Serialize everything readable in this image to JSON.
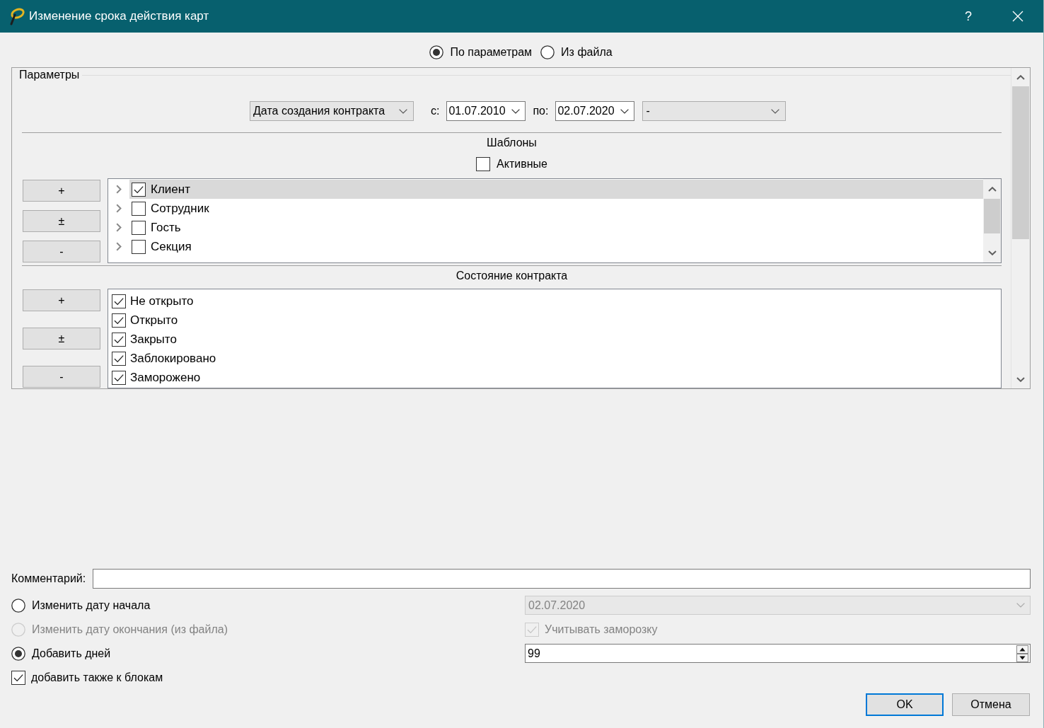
{
  "window": {
    "title": "Изменение срока действия карт",
    "help_button": "?"
  },
  "mode_options": [
    {
      "label": "По параметрам",
      "selected": true
    },
    {
      "label": "Из файла",
      "selected": false
    }
  ],
  "parameters": {
    "title": "Параметры",
    "date_type": "Дата создания контракта",
    "from_label": "с:",
    "from_date": "01.07.2010",
    "to_label": "по:",
    "to_date": "02.07.2020",
    "extra_filter": "-",
    "templates": {
      "title": "Шаблоны",
      "active_only": {
        "label": "Активные",
        "checked": false
      },
      "buttons": [
        "+",
        "±",
        "-"
      ],
      "items": [
        {
          "label": "Клиент",
          "checked": true,
          "selected": true,
          "expanded": false
        },
        {
          "label": "Сотрудник",
          "checked": false,
          "selected": false,
          "expanded": false
        },
        {
          "label": "Гость",
          "checked": false,
          "selected": false,
          "expanded": false
        },
        {
          "label": "Секция",
          "checked": false,
          "selected": false,
          "expanded": false
        }
      ]
    },
    "contract_state": {
      "title": "Состояние контракта",
      "buttons": [
        "+",
        "±",
        "-"
      ],
      "items": [
        {
          "label": "Не открыто",
          "checked": true
        },
        {
          "label": "Открыто",
          "checked": true
        },
        {
          "label": "Закрыто",
          "checked": true
        },
        {
          "label": "Заблокировано",
          "checked": true
        },
        {
          "label": "Заморожено",
          "checked": true
        }
      ]
    }
  },
  "comment": {
    "label": "Комментарий:"
  },
  "change_options": [
    {
      "label": "Изменить дату начала",
      "selected": false,
      "disabled": false,
      "control": {
        "kind": "date_select",
        "value": "02.07.2020",
        "disabled": true
      }
    },
    {
      "label": "Изменить дату окончания (из файла)",
      "selected": false,
      "disabled": true,
      "control": {
        "kind": "checkbox",
        "label": "Учитывать заморозку",
        "checked": true,
        "disabled": true
      }
    },
    {
      "label": "Добавить дней",
      "selected": true,
      "disabled": false,
      "control": {
        "kind": "spin",
        "value": "99",
        "disabled": false
      }
    }
  ],
  "add_to_blocks": {
    "label": "добавить также к блокам",
    "checked": true
  },
  "buttons": [
    {
      "label": "OK",
      "default": true
    },
    {
      "label": "Отмена",
      "default": false
    }
  ]
}
